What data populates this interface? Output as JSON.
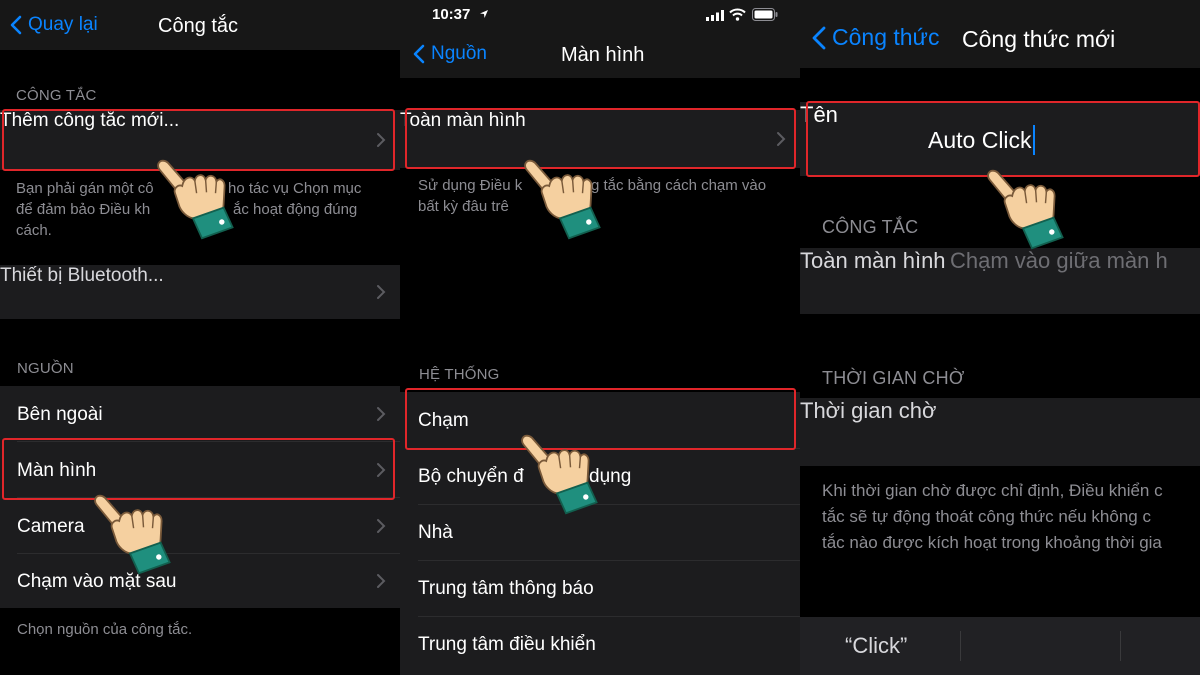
{
  "panel1": {
    "back_label": "Quay lại",
    "title": "Công tắc",
    "section_switch": "CÔNG TẮC",
    "add_switch": "Thêm công tắc mới...",
    "switch_note_line1": "Bạn phải gán một cô",
    "switch_note_line1b": "ho tác vụ Chọn mục",
    "switch_note_line2": "để đảm bảo Điều kh",
    "switch_note_line2b": "ắc hoạt động đúng",
    "switch_note_line3": "cách.",
    "bluetooth": "Thiết bị Bluetooth...",
    "section_source": "NGUỒN",
    "sources": [
      "Bên ngoài",
      "Màn hình",
      "Camera",
      "Chạm vào mặt sau"
    ],
    "source_note": "Chọn nguồn của công tắc."
  },
  "panel2": {
    "time": "10:37",
    "back_label": "Nguồn",
    "title": "Màn hình",
    "fullscreen": "Toàn màn hình",
    "fullscreen_note_line1a": "Sử dụng Điều k",
    "fullscreen_note_line1b": "g tắc bằng cách chạm vào",
    "fullscreen_note_line2": "bất kỳ đâu trê",
    "section_system": "HỆ THỐNG",
    "system_items": [
      "Chạm",
      "Bộ chuyển đ",
      "Nhà",
      "Trung tâm thông báo",
      "Trung tâm điều khiển"
    ],
    "system_item2_tail": "dụng"
  },
  "panel3": {
    "back_label": "Công thức",
    "title": "Công thức mới",
    "name_label": "Tên",
    "name_value": "Auto Click",
    "section_switch": "CÔNG TẮC",
    "switch_label": "Toàn màn hình",
    "switch_value": "Chạm vào giữa màn h",
    "section_timeout": "THỜI GIAN CHỜ",
    "timeout_label": "Thời gian chờ",
    "timeout_note_line1": "Khi thời gian chờ được chỉ định, Điều khiển c",
    "timeout_note_line2": "tắc sẽ tự động thoát công thức nếu không c",
    "timeout_note_line3": "tắc nào được kích hoạt trong khoảng thời gia",
    "keyboard_suggestion": "“Click”"
  },
  "colors": {
    "accent": "#0a84ff",
    "highlight": "#e0262a",
    "cell_bg": "#1c1c1e",
    "secondary_text": "#8d8d93"
  },
  "icons": [
    "chevron-left-icon",
    "chevron-right-icon",
    "pointing-hand-icon",
    "signal-icon",
    "wifi-icon",
    "battery-icon",
    "location-arrow-icon"
  ]
}
